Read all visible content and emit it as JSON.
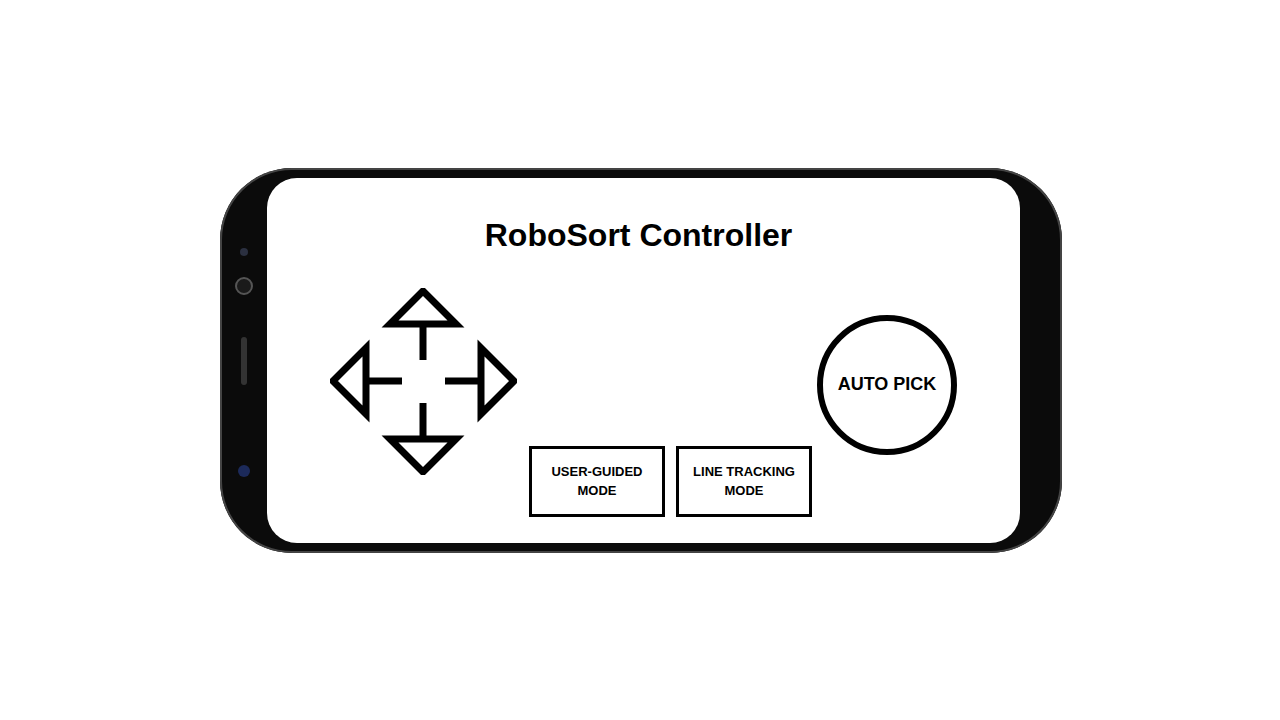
{
  "app": {
    "title": "RoboSort Controller"
  },
  "mode_buttons": [
    {
      "label": "USER-GUIDED MODE"
    },
    {
      "label": "LINE TRACKING MODE"
    }
  ],
  "action_button": {
    "label": "AUTO PICK"
  }
}
